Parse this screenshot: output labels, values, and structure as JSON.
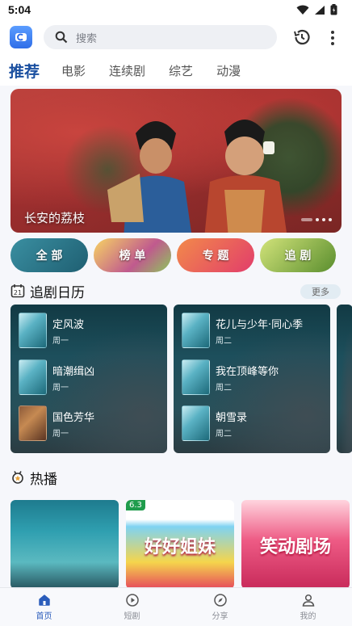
{
  "status_bar": {
    "time": "5:04"
  },
  "top_bar": {
    "search_placeholder": "搜索",
    "icons": [
      "app-logo-icon",
      "search-icon",
      "history-icon",
      "more-vert-icon"
    ]
  },
  "tabs": [
    {
      "label": "推荐",
      "active": true
    },
    {
      "label": "电影",
      "active": false
    },
    {
      "label": "连续剧",
      "active": false
    },
    {
      "label": "综艺",
      "active": false
    },
    {
      "label": "动漫",
      "active": false
    }
  ],
  "banner": {
    "title": "长安的荔枝"
  },
  "categories": [
    {
      "label": "全 部"
    },
    {
      "label": "榜 单"
    },
    {
      "label": "专 题"
    },
    {
      "label": "追 剧"
    }
  ],
  "calendar": {
    "title": "追剧日历",
    "more_label": "更多",
    "columns": [
      {
        "items": [
          {
            "name": "定风波",
            "day": "周一"
          },
          {
            "name": "暗潮缉凶",
            "day": "周一"
          },
          {
            "name": "国色芳华",
            "day": "周一"
          }
        ]
      },
      {
        "items": [
          {
            "name": "花儿与少年·同心季",
            "day": "周二"
          },
          {
            "name": "我在顶峰等你",
            "day": "周二"
          },
          {
            "name": "朝雪录",
            "day": "周二"
          }
        ]
      }
    ]
  },
  "hot": {
    "title": "热播",
    "badge": "6.3",
    "cards": [
      {
        "art": ""
      },
      {
        "art": "好好姐妹"
      },
      {
        "art": "笑动剧场"
      }
    ]
  },
  "bottom_nav": [
    {
      "label": "首页",
      "icon": "home-icon",
      "active": true
    },
    {
      "label": "短剧",
      "icon": "play-circle-icon",
      "active": false
    },
    {
      "label": "分享",
      "icon": "compass-icon",
      "active": false
    },
    {
      "label": "我的",
      "icon": "person-icon",
      "active": false
    }
  ],
  "colors": {
    "accent": "#1a4fa0",
    "nav_active": "#2b5dbb"
  }
}
